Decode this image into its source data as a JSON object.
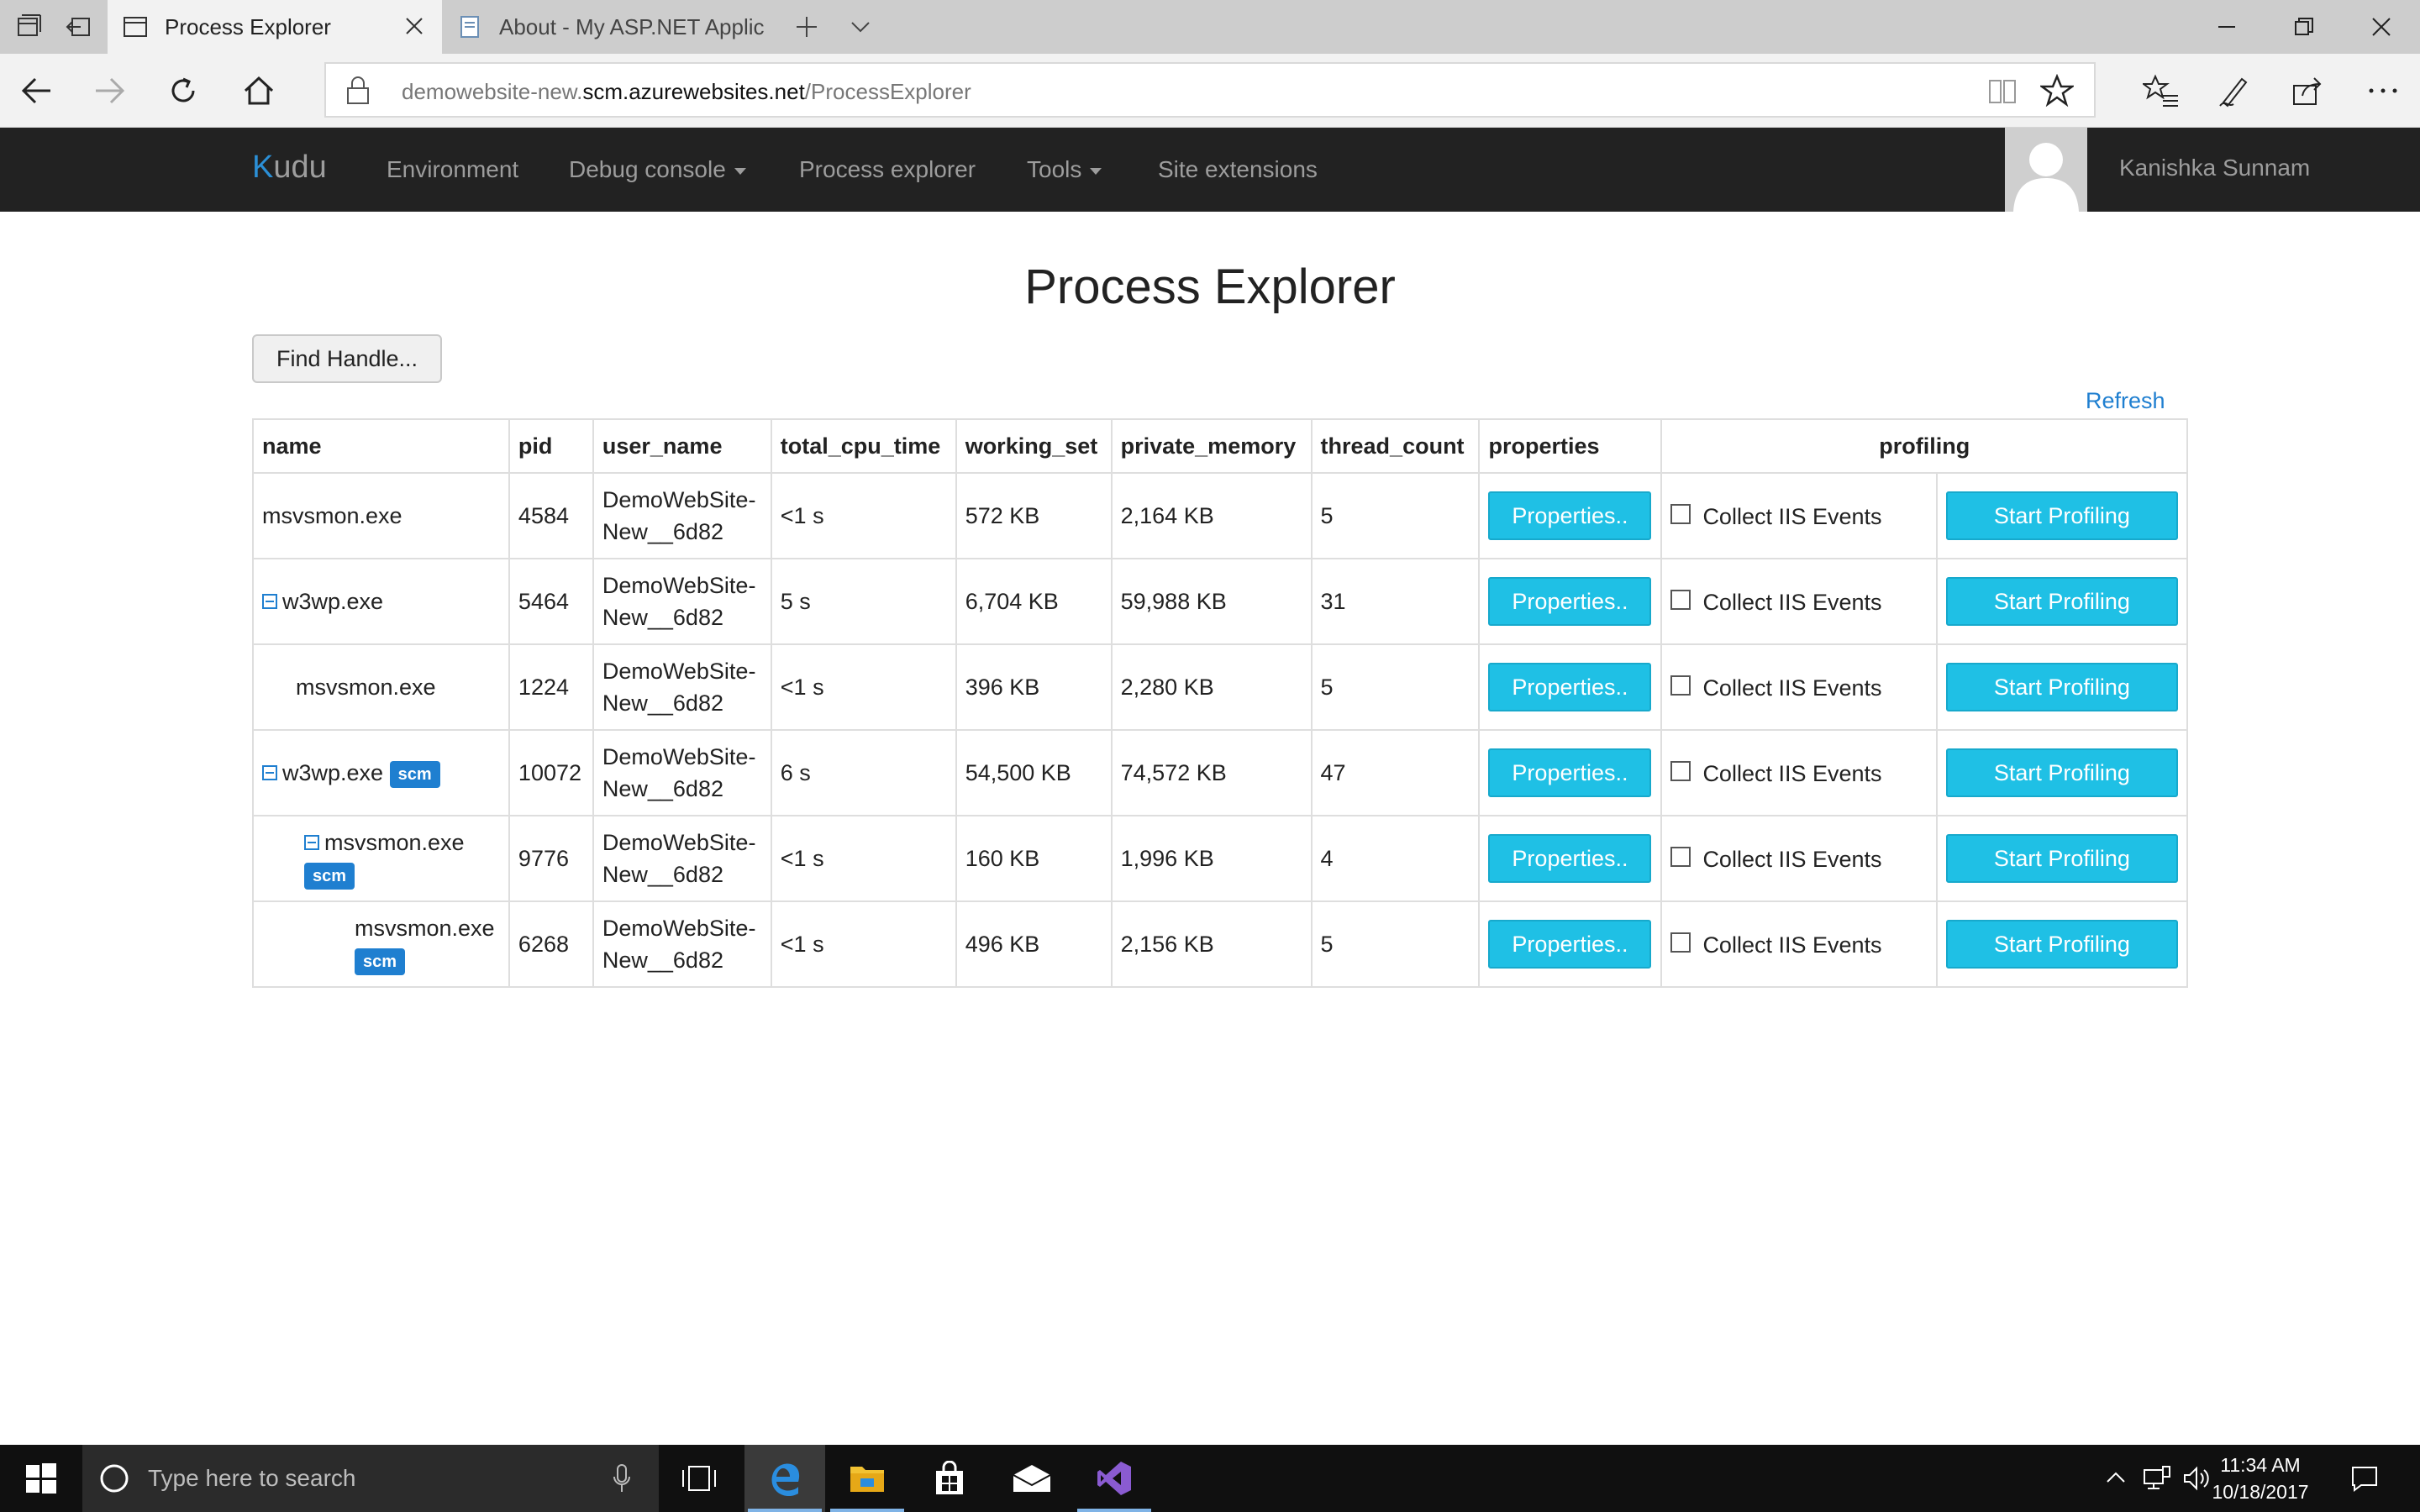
{
  "browser": {
    "tabs": [
      {
        "title": "Process Explorer",
        "active": true
      },
      {
        "title": "About - My ASP.NET Applic",
        "active": false
      }
    ],
    "url_prefix": "demowebsite-new.",
    "url_host": "scm.azurewebsites.net",
    "url_path": "/ProcessExplorer"
  },
  "navbar": {
    "brand_first": "K",
    "brand_rest": "udu",
    "items": [
      "Environment",
      "Debug console",
      "Process explorer",
      "Tools",
      "Site extensions"
    ],
    "user": "Kanishka Sunnam"
  },
  "page": {
    "title": "Process Explorer",
    "find_handle": "Find Handle...",
    "refresh": "Refresh"
  },
  "table": {
    "headers": [
      "name",
      "pid",
      "user_name",
      "total_cpu_time",
      "working_set",
      "private_memory",
      "thread_count",
      "properties",
      "profiling"
    ],
    "properties_label": "Properties..",
    "collect_label": "Collect IIS Events",
    "profile_label": "Start Profiling",
    "badge": "scm",
    "rows": [
      {
        "name": "msvsmon.exe",
        "pid": "4584",
        "user": "DemoWebSite-New__6d82",
        "cpu": "<1 s",
        "ws": "572 KB",
        "pm": "2,164 KB",
        "threads": "5"
      },
      {
        "name": "w3wp.exe",
        "pid": "5464",
        "user": "DemoWebSite-New__6d82",
        "cpu": "5 s",
        "ws": "6,704 KB",
        "pm": "59,988 KB",
        "threads": "31"
      },
      {
        "name": "msvsmon.exe",
        "pid": "1224",
        "user": "DemoWebSite-New__6d82",
        "cpu": "<1 s",
        "ws": "396 KB",
        "pm": "2,280 KB",
        "threads": "5"
      },
      {
        "name": "w3wp.exe",
        "pid": "10072",
        "user": "DemoWebSite-New__6d82",
        "cpu": "6 s",
        "ws": "54,500 KB",
        "pm": "74,572 KB",
        "threads": "47"
      },
      {
        "name": "msvsmon.exe",
        "pid": "9776",
        "user": "DemoWebSite-New__6d82",
        "cpu": "<1 s",
        "ws": "160 KB",
        "pm": "1,996 KB",
        "threads": "4"
      },
      {
        "name": "msvsmon.exe",
        "pid": "6268",
        "user": "DemoWebSite-New__6d82",
        "cpu": "<1 s",
        "ws": "496 KB",
        "pm": "2,156 KB",
        "threads": "5"
      }
    ]
  },
  "taskbar": {
    "search_placeholder": "Type here to search",
    "time": "11:34 AM",
    "date": "10/18/2017"
  },
  "colors": {
    "accent_button": "#1fc0e5",
    "link": "#1f7fd0",
    "navbar_bg": "#222222"
  }
}
